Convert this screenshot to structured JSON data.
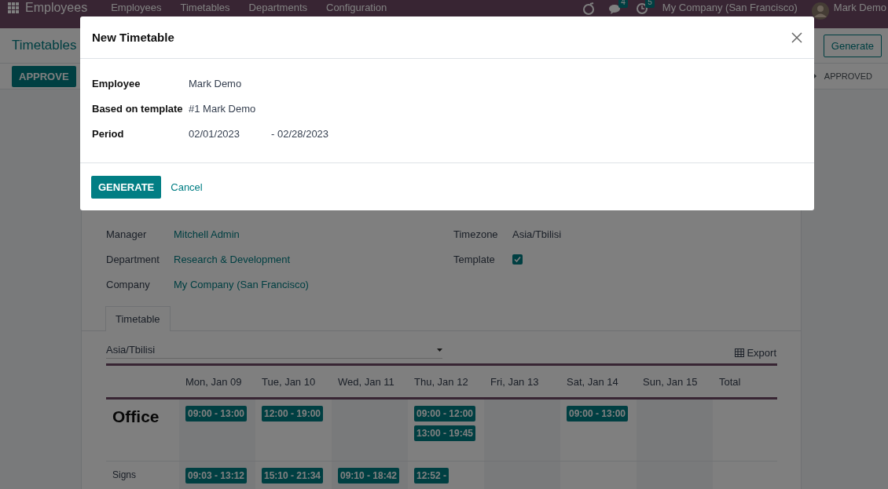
{
  "navbar": {
    "app_name": "Employees",
    "menu": [
      "Employees",
      "Timetables",
      "Departments",
      "Configuration"
    ],
    "messages_badge": "4",
    "activities_badge": "5",
    "company": "My Company (San Francisco)",
    "user": "Mark Demo"
  },
  "breadcrumb": "Timetables",
  "generate_button": "Generate",
  "approve_button": "APPROVE",
  "status": "APPROVED",
  "form": {
    "left_fields": [
      {
        "label": "Manager",
        "value": "Mitchell Admin"
      },
      {
        "label": "Department",
        "value": "Research & Development"
      },
      {
        "label": "Company",
        "value": "My Company (San Francisco)"
      }
    ],
    "right_fields": [
      {
        "label": "Timezone",
        "kind": "text",
        "value": "Asia/Tbilisi"
      },
      {
        "label": "Template",
        "kind": "checkbox",
        "checked": true
      }
    ]
  },
  "tabs": [
    {
      "label": "Timetable",
      "selected": true
    }
  ],
  "timezone_select": "Asia/Tbilisi",
  "export_button": "Export",
  "table": {
    "columns": [
      "Mon, Jan 09",
      "Tue, Jan 10",
      "Wed, Jan 11",
      "Thu, Jan 12",
      "Fri, Jan 13",
      "Sat, Jan 14",
      "Sun, Jan 15",
      "Total"
    ],
    "rows": [
      {
        "label": "Office",
        "kind": "heading",
        "cells": [
          [
            "09:00 - 13:00"
          ],
          [
            "12:00 - 19:00"
          ],
          [],
          [
            "09:00 - 12:00",
            "13:00 - 19:45"
          ],
          [],
          [
            "09:00 - 13:00"
          ],
          []
        ]
      },
      {
        "label": "Signs",
        "kind": "subrow",
        "cells": [
          [
            "09:03 - 13:12"
          ],
          [
            "15:10 - 21:34"
          ],
          [
            "09:10 - 18:42"
          ],
          [
            "12:52 -"
          ],
          [],
          [],
          []
        ]
      }
    ]
  },
  "dialog": {
    "title": "New Timetable",
    "fields": [
      {
        "label": "Employee",
        "value": "Mark Demo"
      },
      {
        "label": "Based on template",
        "value": "#1 Mark Demo"
      }
    ],
    "period": {
      "label": "Period",
      "start": "02/01/2023",
      "end": "- 02/28/2023"
    },
    "primary_button": "GENERATE",
    "secondary_button": "Cancel"
  }
}
